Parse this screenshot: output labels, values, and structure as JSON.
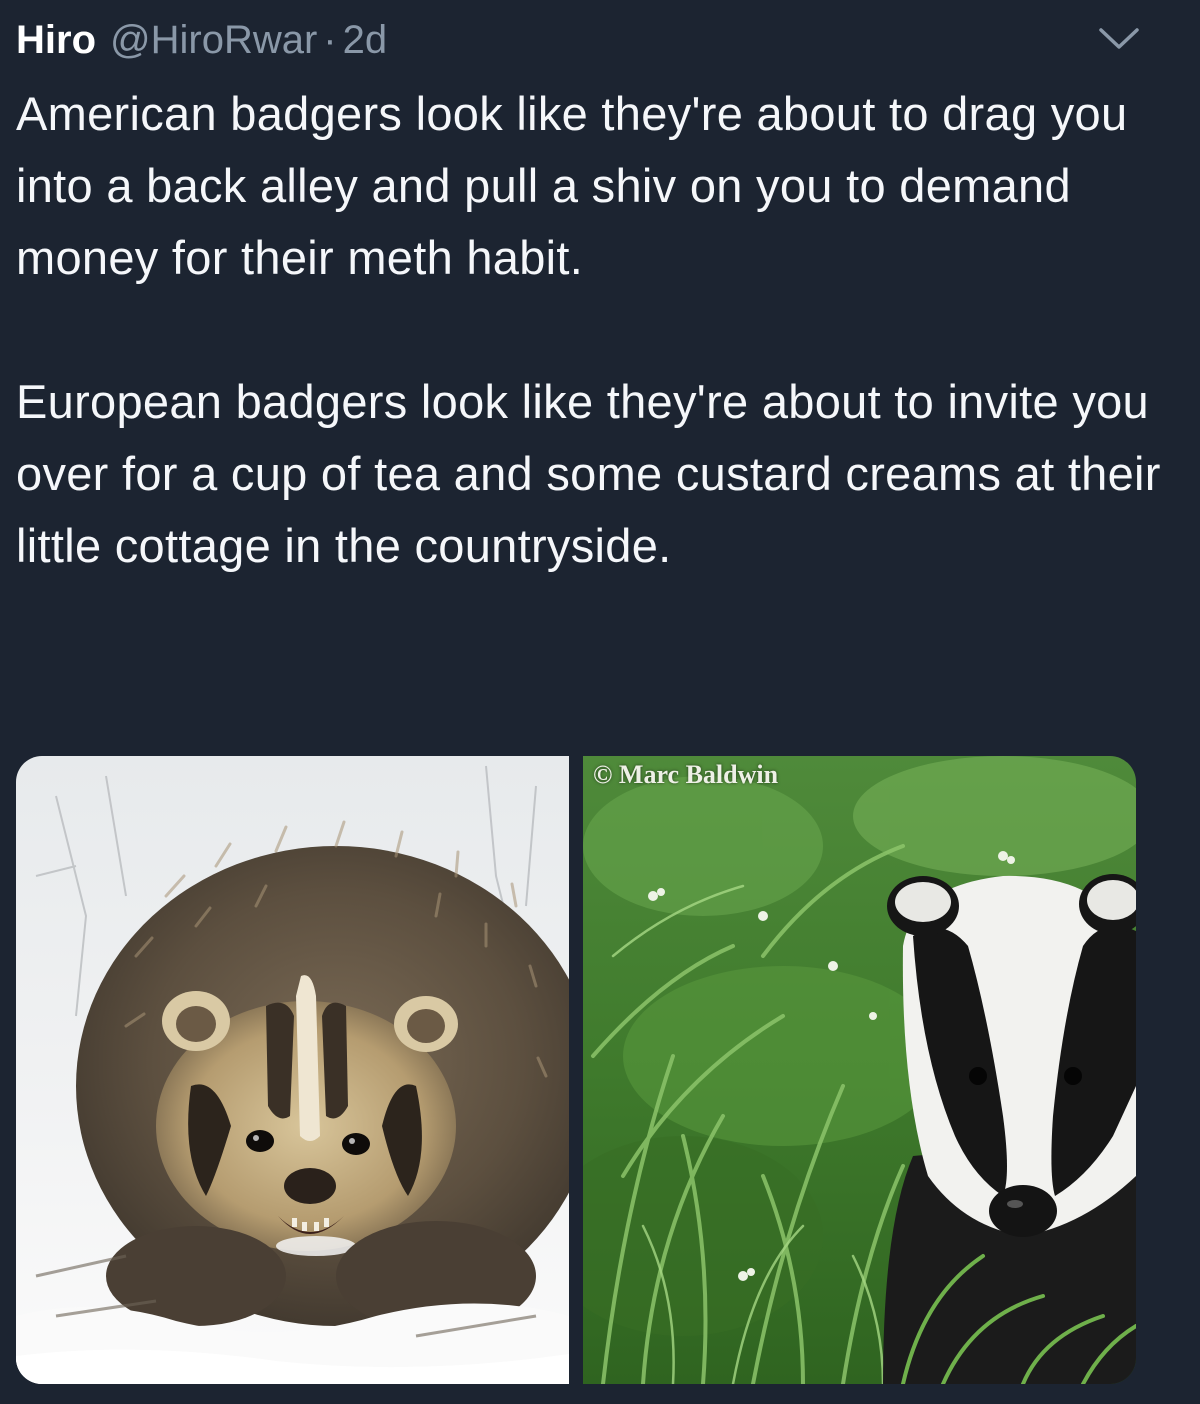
{
  "tweet": {
    "display_name": "Hiro",
    "handle": "@HiroRwar",
    "separator": "·",
    "time": "2d",
    "paragraphs": [
      "American badgers look like they're about to drag you into a back alley and pull a shiv on you to demand money for their meth habit.",
      "European badgers look like they're about to invite you over for a cup of tea and some custard creams at their little cottage in the countryside."
    ],
    "menu_icon": "chevron-down-icon"
  },
  "media": {
    "photos": [
      {
        "subject": "american-badger-in-snow"
      },
      {
        "subject": "european-badger-in-grass",
        "watermark": "© Marc Baldwin"
      }
    ]
  },
  "colors": {
    "background": "#1c2431",
    "text": "#f5f7fa",
    "secondary_text": "#8a98a8"
  }
}
